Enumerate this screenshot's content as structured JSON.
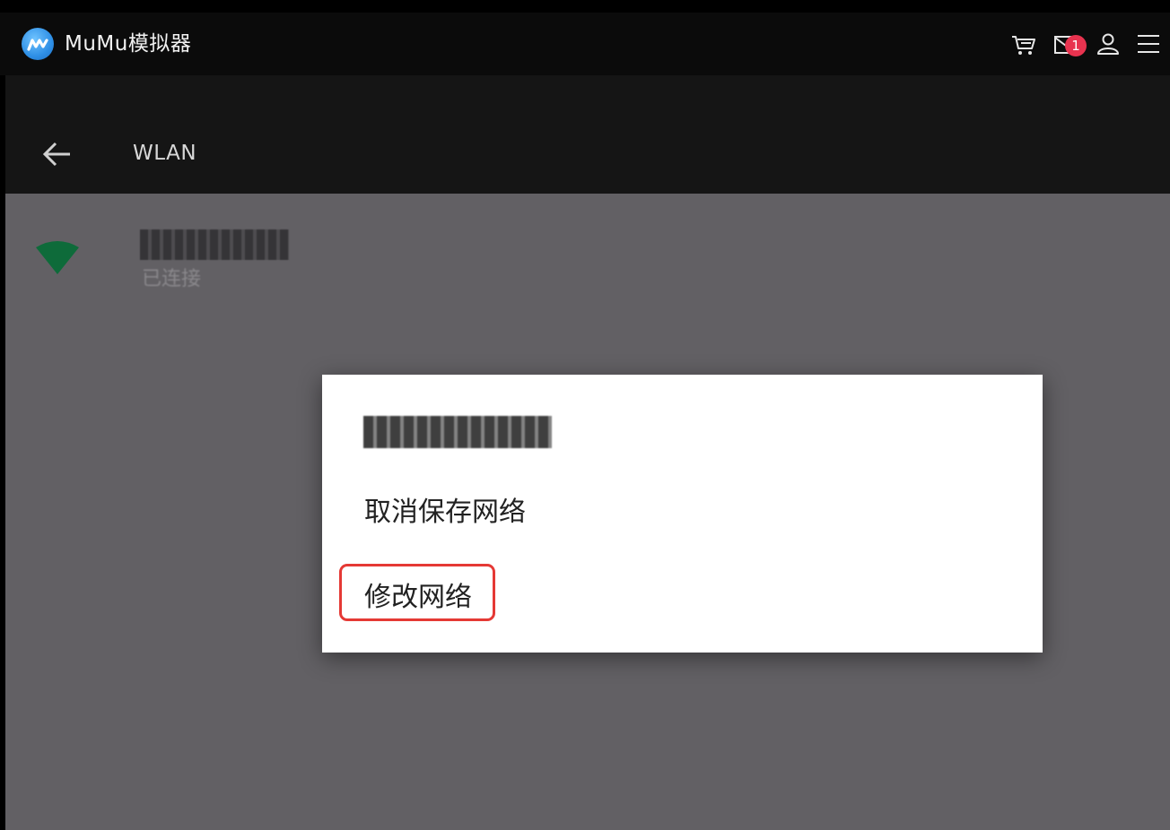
{
  "app": {
    "title": "MuMu模拟器",
    "notification_count": "1"
  },
  "titlebar_icons": [
    "cart-icon",
    "mail-icon",
    "user-icon",
    "menu-icon"
  ],
  "actionbar": {
    "title": "WLAN"
  },
  "network": {
    "status": "已连接"
  },
  "dialog": {
    "items": [
      {
        "label": "取消保存网络"
      },
      {
        "label": "修改网络"
      }
    ],
    "highlighted_item": "修改网络"
  },
  "colors": {
    "titlebar_bg": "#0b0b0b",
    "actionbar_bg": "#151515",
    "content_dim": "#626064",
    "wifi_green": "#0e6b3a",
    "highlight_red": "#e53935",
    "badge_red": "#e8334f"
  }
}
